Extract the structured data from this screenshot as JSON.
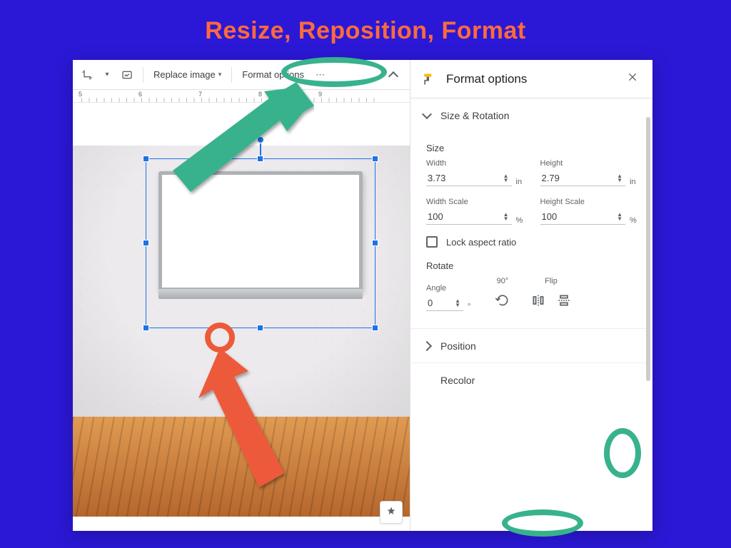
{
  "page": {
    "title": "Resize, Reposition, Format"
  },
  "toolbar": {
    "replace_image": "Replace image",
    "format_options": "Format options"
  },
  "ruler": {
    "labels": [
      "5",
      "6",
      "7",
      "8",
      "9"
    ]
  },
  "sidebar": {
    "title": "Format options",
    "size_rotation_label": "Size & Rotation",
    "size_heading": "Size",
    "width_label": "Width",
    "height_label": "Height",
    "width_value": "3.73",
    "height_value": "2.79",
    "dim_unit": "in",
    "width_scale_label": "Width Scale",
    "height_scale_label": "Height Scale",
    "width_scale_value": "100",
    "height_scale_value": "100",
    "scale_unit": "%",
    "lock_aspect_label": "Lock aspect ratio",
    "rotate_heading": "Rotate",
    "angle_label": "Angle",
    "angle_value": "0",
    "angle_unit": "°",
    "ninety_label": "90°",
    "flip_label": "Flip",
    "position_label": "Position",
    "recolor_label": "Recolor"
  },
  "annotation": {
    "highlight_format_options": true,
    "highlight_flip": true,
    "highlight_recolor": true
  }
}
